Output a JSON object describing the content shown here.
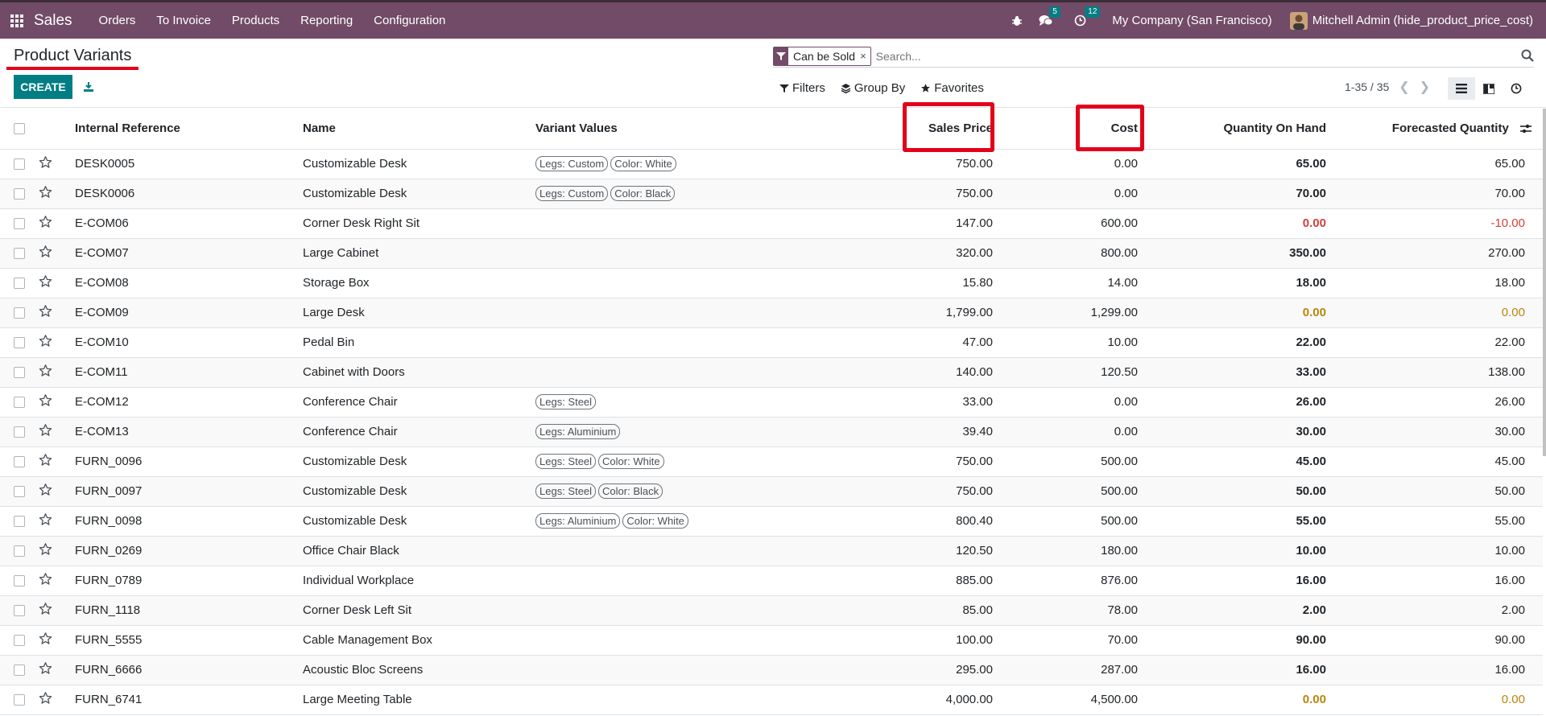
{
  "navbar": {
    "brand": "Sales",
    "menu": [
      "Orders",
      "To Invoice",
      "Products",
      "Reporting",
      "Configuration"
    ],
    "messages_count": "5",
    "activities_count": "12",
    "company": "My Company (San Francisco)",
    "user": "Mitchell Admin (hide_product_price_cost)"
  },
  "control_panel": {
    "title": "Product Variants",
    "create_label": "CREATE",
    "facet_label": "Can be Sold",
    "facet_close": "×",
    "search_placeholder": "Search...",
    "filters_label": "Filters",
    "group_by_label": "Group By",
    "favorites_label": "Favorites",
    "pager": "1-35 / 35"
  },
  "table": {
    "headers": {
      "internal_ref": "Internal Reference",
      "name": "Name",
      "variant_values": "Variant Values",
      "sales_price": "Sales Price",
      "cost": "Cost",
      "qty_on_hand": "Quantity On Hand",
      "forecasted": "Forecasted Quantity"
    },
    "rows": [
      {
        "ref": "DESK0005",
        "name": "Customizable Desk",
        "tags": [
          "Legs: Custom",
          "Color: White"
        ],
        "price": "750.00",
        "cost": "0.00",
        "qty": "65.00",
        "forecast": "65.00",
        "qty_style": "",
        "forecast_style": ""
      },
      {
        "ref": "DESK0006",
        "name": "Customizable Desk",
        "tags": [
          "Legs: Custom",
          "Color: Black"
        ],
        "price": "750.00",
        "cost": "0.00",
        "qty": "70.00",
        "forecast": "70.00",
        "qty_style": "",
        "forecast_style": ""
      },
      {
        "ref": "E-COM06",
        "name": "Corner Desk Right Sit",
        "tags": [],
        "price": "147.00",
        "cost": "600.00",
        "qty": "0.00",
        "forecast": "-10.00",
        "qty_style": "red",
        "forecast_style": "red"
      },
      {
        "ref": "E-COM07",
        "name": "Large Cabinet",
        "tags": [],
        "price": "320.00",
        "cost": "800.00",
        "qty": "350.00",
        "forecast": "270.00",
        "qty_style": "",
        "forecast_style": ""
      },
      {
        "ref": "E-COM08",
        "name": "Storage Box",
        "tags": [],
        "price": "15.80",
        "cost": "14.00",
        "qty": "18.00",
        "forecast": "18.00",
        "qty_style": "",
        "forecast_style": ""
      },
      {
        "ref": "E-COM09",
        "name": "Large Desk",
        "tags": [],
        "price": "1,799.00",
        "cost": "1,299.00",
        "qty": "0.00",
        "forecast": "0.00",
        "qty_style": "amber",
        "forecast_style": "amber"
      },
      {
        "ref": "E-COM10",
        "name": "Pedal Bin",
        "tags": [],
        "price": "47.00",
        "cost": "10.00",
        "qty": "22.00",
        "forecast": "22.00",
        "qty_style": "",
        "forecast_style": ""
      },
      {
        "ref": "E-COM11",
        "name": "Cabinet with Doors",
        "tags": [],
        "price": "140.00",
        "cost": "120.50",
        "qty": "33.00",
        "forecast": "138.00",
        "qty_style": "",
        "forecast_style": ""
      },
      {
        "ref": "E-COM12",
        "name": "Conference Chair",
        "tags": [
          "Legs: Steel"
        ],
        "price": "33.00",
        "cost": "0.00",
        "qty": "26.00",
        "forecast": "26.00",
        "qty_style": "",
        "forecast_style": ""
      },
      {
        "ref": "E-COM13",
        "name": "Conference Chair",
        "tags": [
          "Legs: Aluminium"
        ],
        "price": "39.40",
        "cost": "0.00",
        "qty": "30.00",
        "forecast": "30.00",
        "qty_style": "",
        "forecast_style": ""
      },
      {
        "ref": "FURN_0096",
        "name": "Customizable Desk",
        "tags": [
          "Legs: Steel",
          "Color: White"
        ],
        "price": "750.00",
        "cost": "500.00",
        "qty": "45.00",
        "forecast": "45.00",
        "qty_style": "",
        "forecast_style": ""
      },
      {
        "ref": "FURN_0097",
        "name": "Customizable Desk",
        "tags": [
          "Legs: Steel",
          "Color: Black"
        ],
        "price": "750.00",
        "cost": "500.00",
        "qty": "50.00",
        "forecast": "50.00",
        "qty_style": "",
        "forecast_style": ""
      },
      {
        "ref": "FURN_0098",
        "name": "Customizable Desk",
        "tags": [
          "Legs: Aluminium",
          "Color: White"
        ],
        "price": "800.40",
        "cost": "500.00",
        "qty": "55.00",
        "forecast": "55.00",
        "qty_style": "",
        "forecast_style": ""
      },
      {
        "ref": "FURN_0269",
        "name": "Office Chair Black",
        "tags": [],
        "price": "120.50",
        "cost": "180.00",
        "qty": "10.00",
        "forecast": "10.00",
        "qty_style": "",
        "forecast_style": ""
      },
      {
        "ref": "FURN_0789",
        "name": "Individual Workplace",
        "tags": [],
        "price": "885.00",
        "cost": "876.00",
        "qty": "16.00",
        "forecast": "16.00",
        "qty_style": "",
        "forecast_style": ""
      },
      {
        "ref": "FURN_1118",
        "name": "Corner Desk Left Sit",
        "tags": [],
        "price": "85.00",
        "cost": "78.00",
        "qty": "2.00",
        "forecast": "2.00",
        "qty_style": "",
        "forecast_style": ""
      },
      {
        "ref": "FURN_5555",
        "name": "Cable Management Box",
        "tags": [],
        "price": "100.00",
        "cost": "70.00",
        "qty": "90.00",
        "forecast": "90.00",
        "qty_style": "",
        "forecast_style": ""
      },
      {
        "ref": "FURN_6666",
        "name": "Acoustic Bloc Screens",
        "tags": [],
        "price": "295.00",
        "cost": "287.00",
        "qty": "16.00",
        "forecast": "16.00",
        "qty_style": "",
        "forecast_style": ""
      },
      {
        "ref": "FURN_6741",
        "name": "Large Meeting Table",
        "tags": [],
        "price": "4,000.00",
        "cost": "4,500.00",
        "qty": "0.00",
        "forecast": "0.00",
        "qty_style": "amber",
        "forecast_style": "amber"
      }
    ]
  },
  "colors": {
    "brand": "#714b67",
    "primary": "#017e84",
    "highlight": "#e3001b"
  }
}
